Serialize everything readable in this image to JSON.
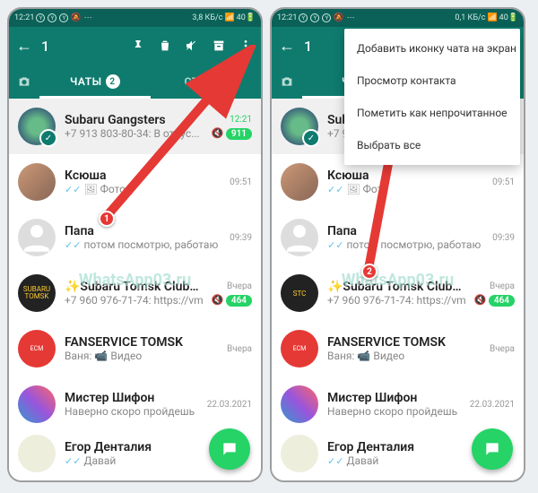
{
  "status": {
    "time": "12:21",
    "net_speed_left": "3,8 КБ/с",
    "net_speed_right": "0,1 КБ/с",
    "signal": "▂▃▄▅",
    "battery": "40"
  },
  "header": {
    "selected_count": "1"
  },
  "tabs": {
    "chats": "ЧАТЫ",
    "chats_badge": "2",
    "status": "СТАТУС"
  },
  "menu": {
    "items": [
      "Добавить иконку чата на экран",
      "Просмотр контакта",
      "Пометить как непрочитанное",
      "Выбрать все"
    ]
  },
  "chats": [
    {
      "name": "Subaru Gangsters",
      "msg": "+7 913 803-80-34: В отпус...",
      "time": "12:21",
      "badge": "911",
      "muted": true,
      "time_green": true,
      "avatar": "sg"
    },
    {
      "name": "Ксюша",
      "msg_prefix_icon": "photo",
      "msg": "Фото",
      "time": "09:51",
      "tick": true,
      "avatar": "ks"
    },
    {
      "name": "Папа",
      "msg": "потом посмотрю, работаю",
      "time": "09:39",
      "tick": true,
      "avatar": "default"
    },
    {
      "name": "✨Subaru Tomsk Club✨",
      "msg": "+7 960 976-71-74: https://vm...",
      "time": "Вчера",
      "badge": "464",
      "muted": true,
      "avatar": "stc"
    },
    {
      "name": "FANSERVICE TOMSK",
      "msg_prefix": "Ваня: ",
      "msg_prefix_icon": "video",
      "msg": "Видео",
      "time": "Вчера",
      "avatar": "fs"
    },
    {
      "name": "Мистер Шифон",
      "msg": "Наверно скоро пройдешь",
      "time": "22.03.2021",
      "avatar": "ms"
    },
    {
      "name": "Егор Денталия",
      "msg": "Давай",
      "time": "",
      "avatar": "ed",
      "tick": true
    }
  ],
  "markers": {
    "m1": "1",
    "m2": "2"
  },
  "watermark": "WhatsApp03.ru"
}
